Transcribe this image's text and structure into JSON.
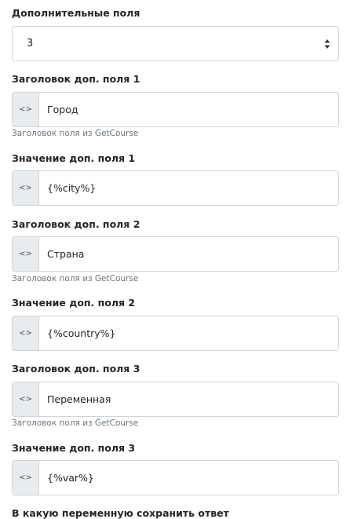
{
  "additional_fields": {
    "label": "Дополнительные поля",
    "selected_value": "3"
  },
  "fields": [
    {
      "label": "Заголовок доп. поля 1",
      "value": "Город",
      "help": "Заголовок поля из GetCourse"
    },
    {
      "label": "Значение доп. поля 1",
      "value": "{%city%}"
    },
    {
      "label": "Заголовок доп. поля 2",
      "value": "Страна",
      "help": "Заголовок поля из GetCourse"
    },
    {
      "label": "Значение доп. поля 2",
      "value": "{%country%}"
    },
    {
      "label": "Заголовок доп. поля 3",
      "value": "Переменная",
      "help": "Заголовок поля из GetCourse"
    },
    {
      "label": "Значение доп. поля 3",
      "value": "{%var%}"
    }
  ],
  "next_section": {
    "label": "В какую переменную сохранить ответ"
  },
  "icons": {
    "code_icon": "<>",
    "select_arrows": "sort-arrows-icon"
  }
}
